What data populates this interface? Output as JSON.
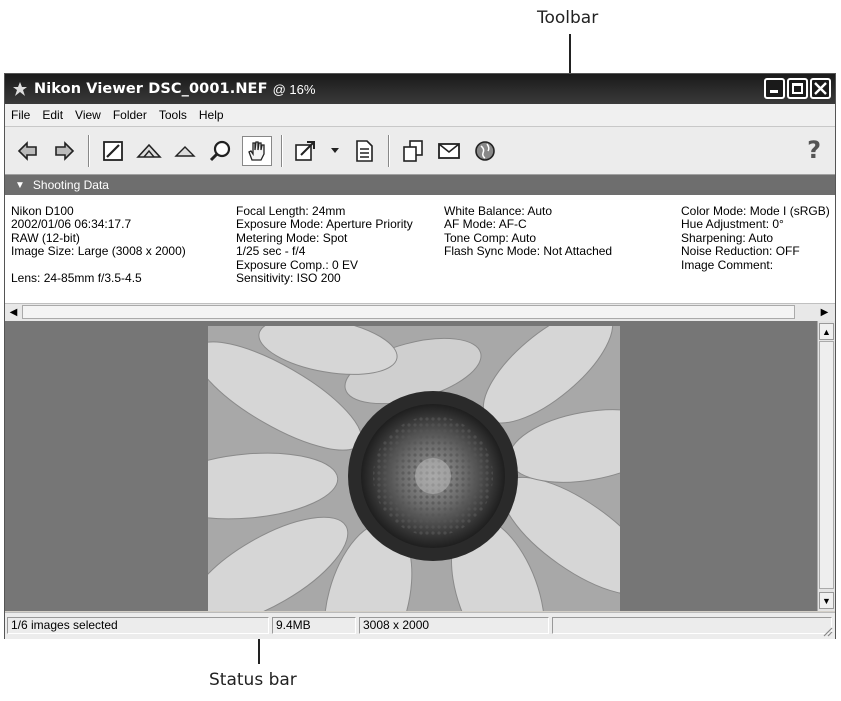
{
  "callouts": {
    "toolbar": "Toolbar",
    "status_bar": "Status bar"
  },
  "window": {
    "title": "Nikon Viewer DSC_0001.NEF",
    "zoom": "@ 16%"
  },
  "menu": [
    "File",
    "Edit",
    "View",
    "Folder",
    "Tools",
    "Help"
  ],
  "toolbar_icons": [
    "back-arrow-icon",
    "forward-arrow-icon",
    "edit-image-icon",
    "rotate-left-icon",
    "rotate-right-icon",
    "zoom-icon",
    "hand-icon",
    "open-with-icon",
    "dropdown-arrow-icon",
    "properties-icon",
    "copy-icon",
    "email-icon",
    "web-icon",
    "help-icon"
  ],
  "help_label": "?",
  "shooting_data": {
    "header": "Shooting Data",
    "col1": [
      "Nikon D100",
      "2002/01/06 06:34:17.7",
      "RAW (12-bit)",
      "Image Size:  Large (3008 x 2000)",
      "",
      "Lens: 24-85mm f/3.5-4.5"
    ],
    "col2": [
      "Focal Length: 24mm",
      "Exposure Mode: Aperture Priority",
      "Metering Mode: Spot",
      "1/25 sec - f/4",
      "Exposure Comp.: 0 EV",
      "Sensitivity: ISO 200"
    ],
    "col3": [
      "White Balance: Auto",
      "AF Mode: AF-C",
      "Tone Comp: Auto",
      "Flash Sync Mode: Not Attached"
    ],
    "col4": [
      "Color Mode: Mode I (sRGB)",
      "Hue Adjustment: 0°",
      "Sharpening: Auto",
      "Noise Reduction: OFF",
      "Image Comment:"
    ]
  },
  "status": {
    "selection": "1/6 images selected",
    "size": "9.4MB",
    "dimensions": "3008 x 2000",
    "extra1": "",
    "extra2": ""
  },
  "colors": {
    "titlebar": "#1a1a1a",
    "section_header": "#6e6e6e",
    "viewer_bg": "#767676"
  }
}
